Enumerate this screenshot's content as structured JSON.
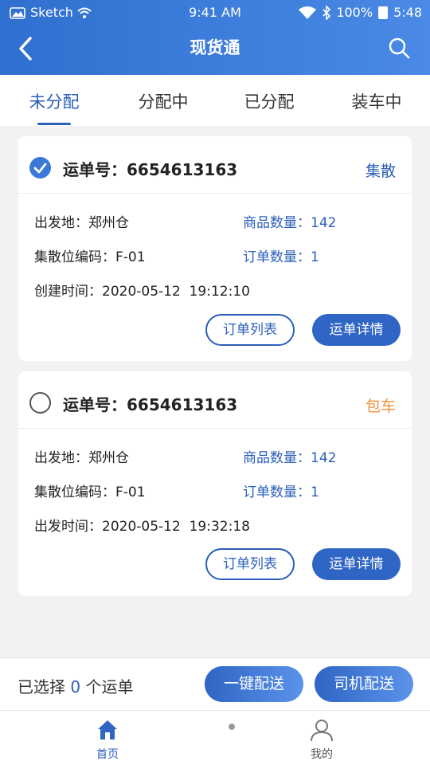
{
  "status_bar": {
    "carrier": "Sketch",
    "time": "9:41 AM",
    "battery": "100%",
    "clock": "5:48"
  },
  "nav": {
    "title": "现货通",
    "back_icon": "back-chevron-icon",
    "search_icon": "search-icon"
  },
  "tabs": [
    {
      "label": "未分配",
      "active": true
    },
    {
      "label": "分配中",
      "active": false
    },
    {
      "label": "已分配",
      "active": false
    },
    {
      "label": "装车中",
      "active": false
    }
  ],
  "orders": [
    {
      "selected": true,
      "waybill_label": "运单号：",
      "waybill_no": "6654613163",
      "tag": "集散",
      "tag_color": "#2a5fb8",
      "origin": "出发地：郑州仓",
      "hub_code": "集散位编码：F-01",
      "time": "创建时间：2020-05-12  19:12:10",
      "goods_qty": "商品数量：142",
      "order_qty": "订单数量：1",
      "btn_list": "订单列表",
      "btn_detail": "运单详情"
    },
    {
      "selected": false,
      "waybill_label": "运单号：",
      "waybill_no": "6654613163",
      "tag": "包车",
      "tag_color": "#f0913a",
      "origin": "出发地：郑州仓",
      "hub_code": "集散位编码：F-01",
      "time": "出发时间：2020-05-12  19:32:18",
      "goods_qty": "商品数量：142",
      "order_qty": "订单数量：1",
      "btn_list": "订单列表",
      "btn_detail": "运单详情"
    }
  ],
  "selection": {
    "prefix": "已选择 ",
    "count": "0",
    "suffix": " 个运单"
  },
  "actions": {
    "one_click": "一键配送",
    "driver": "司机配送"
  },
  "tabbar": [
    {
      "label": "首页",
      "icon": "home-icon",
      "active": true
    },
    {
      "label": "我的",
      "icon": "user-icon",
      "active": false
    }
  ],
  "colors": {
    "primary": "#2a5fb8",
    "header_start": "#2f6fcf",
    "header_end": "#4a8ae6",
    "tag_orange": "#f0913a"
  }
}
